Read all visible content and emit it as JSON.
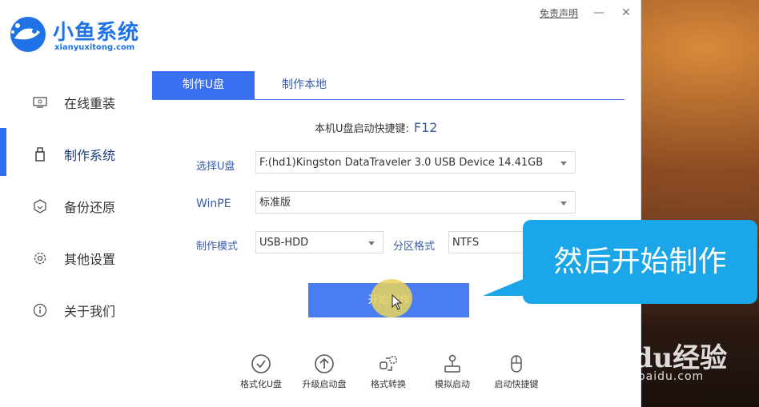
{
  "brand": {
    "name": "小鱼系统",
    "domain": "xianyuxitong.com"
  },
  "topbar": {
    "disclaimer": "免责声明"
  },
  "sidebar": {
    "items": [
      {
        "label": "在线重装",
        "icon": "monitor-icon"
      },
      {
        "label": "制作系统",
        "icon": "usb-drive-icon",
        "active": true
      },
      {
        "label": "备份还原",
        "icon": "backup-icon"
      },
      {
        "label": "其他设置",
        "icon": "gear-icon"
      },
      {
        "label": "关于我们",
        "icon": "info-icon"
      }
    ]
  },
  "tabs": [
    {
      "label": "制作U盘",
      "active": true
    },
    {
      "label": "制作本地",
      "active": false
    }
  ],
  "hotkey": {
    "label": "本机U盘启动快捷键:",
    "key": "F12"
  },
  "form": {
    "usb_label": "选择U盘",
    "usb_value": "F:(hd1)Kingston DataTraveler 3.0 USB Device 14.41GB",
    "winpe_label": "WinPE",
    "winpe_value": "标准版",
    "mode_label": "制作模式",
    "mode_value": "USB-HDD",
    "partition_label": "分区格式",
    "partition_value": "NTFS"
  },
  "start_button": "开始制作",
  "tools": [
    {
      "label": "格式化U盘",
      "icon": "check-circle-icon"
    },
    {
      "label": "升级启动盘",
      "icon": "upgrade-arrow-icon"
    },
    {
      "label": "格式转换",
      "icon": "convert-icon"
    },
    {
      "label": "模拟启动",
      "icon": "joystick-icon"
    },
    {
      "label": "启动快捷键",
      "icon": "mouse-icon"
    }
  ],
  "callout": "然后开始制作",
  "watermark": {
    "title": "Baidu经验",
    "sub": "jingyan.baidu.com"
  },
  "colors": {
    "accent": "#3a6ff2",
    "callout": "#1aa6e8",
    "label": "#3a5ba8"
  }
}
